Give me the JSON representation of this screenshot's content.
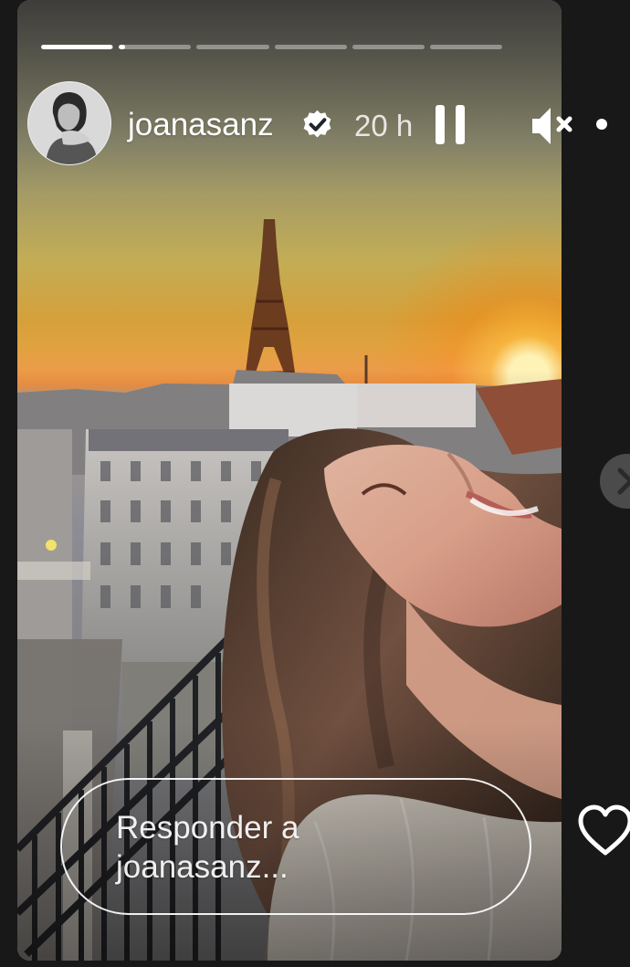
{
  "story": {
    "username": "joanasanz",
    "time": "20 h",
    "segments": [
      0.98,
      0.08,
      0,
      0,
      0,
      0
    ]
  },
  "header": {
    "verified_icon": "verified-badge-icon",
    "pause_icon": "pause-icon",
    "mute_icon": "volume-muted-icon",
    "more_icon": "more-icon"
  },
  "reply": {
    "text": "Responder a joanasanz..."
  },
  "colors": {
    "background": "#181818",
    "progress_active": "#ffffff",
    "progress_inactive": "rgba(255,255,255,0.38)",
    "text": "#ffffff"
  }
}
